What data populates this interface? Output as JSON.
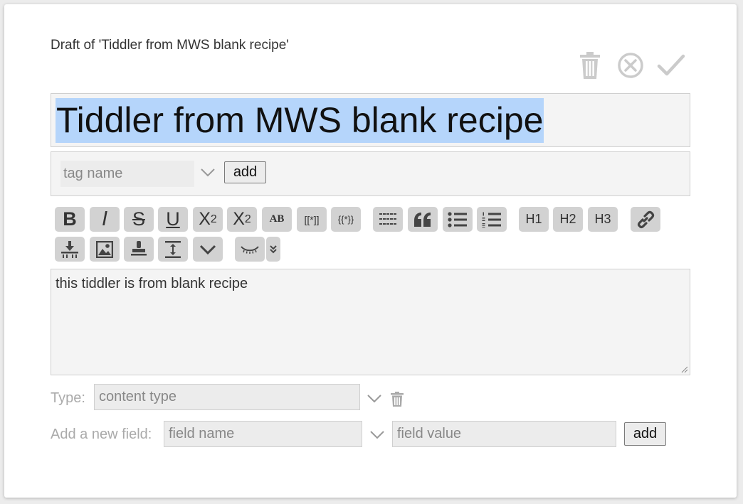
{
  "draft_title": "Draft of 'Tiddler from MWS blank recipe'",
  "controls": {
    "delete_icon": "trash-icon",
    "cancel_icon": "circle-x-icon",
    "done_icon": "checkmark-icon"
  },
  "title_field": {
    "value": "Tiddler from MWS blank recipe"
  },
  "tags": {
    "placeholder": "tag name",
    "add_label": "add"
  },
  "toolbar": {
    "bold": "B",
    "italic": "I",
    "strike": "S",
    "underline": "U",
    "superscript": {
      "base": "X",
      "mark": "2"
    },
    "subscript": {
      "base": "X",
      "mark": "2"
    },
    "smallcaps": "AB",
    "wikilink": "[[*]]",
    "transclude": "{{*}}",
    "heading1": "H1",
    "heading2": "H2",
    "heading3": "H3"
  },
  "editor": {
    "text": "this tiddler is from blank recipe"
  },
  "type_field": {
    "label": "Type:",
    "placeholder": "content type"
  },
  "new_field": {
    "label": "Add a new field:",
    "name_placeholder": "field name",
    "value_placeholder": "field value",
    "add_label": "add"
  }
}
